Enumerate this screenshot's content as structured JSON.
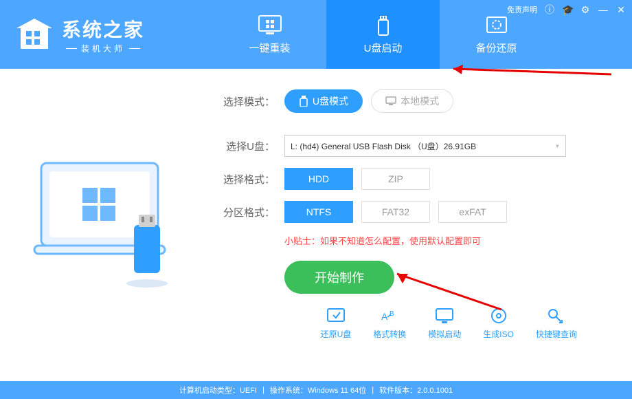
{
  "header": {
    "logo_title": "系统之家",
    "logo_sub": "装机大师",
    "tabs": [
      {
        "label": "一键重装"
      },
      {
        "label": "U盘启动"
      },
      {
        "label": "备份还原"
      }
    ],
    "disclaimer": "免责声明",
    "win_controls": {
      "min": "—",
      "close": "✕"
    }
  },
  "form": {
    "mode_label": "选择模式：",
    "mode_usb": "U盘模式",
    "mode_local": "本地模式",
    "disk_label": "选择U盘：",
    "disk_value": "L: (hd4) General USB Flash Disk （U盘）26.91GB",
    "format_label": "选择格式：",
    "format_opts": [
      "HDD",
      "ZIP"
    ],
    "partition_label": "分区格式：",
    "partition_opts": [
      "NTFS",
      "FAT32",
      "exFAT"
    ],
    "tip": "小贴士：如果不知道怎么配置，使用默认配置即可",
    "start": "开始制作"
  },
  "tools": [
    {
      "label": "还原U盘"
    },
    {
      "label": "格式转换"
    },
    {
      "label": "模拟启动"
    },
    {
      "label": "生成ISO"
    },
    {
      "label": "快捷键查询"
    }
  ],
  "statusbar": {
    "boot_type_label": "计算机启动类型：",
    "boot_type": "UEFI",
    "os_label": "操作系统：",
    "os": "Windows 11 64位",
    "ver_label": "软件版本：",
    "ver": "2.0.0.1001"
  }
}
